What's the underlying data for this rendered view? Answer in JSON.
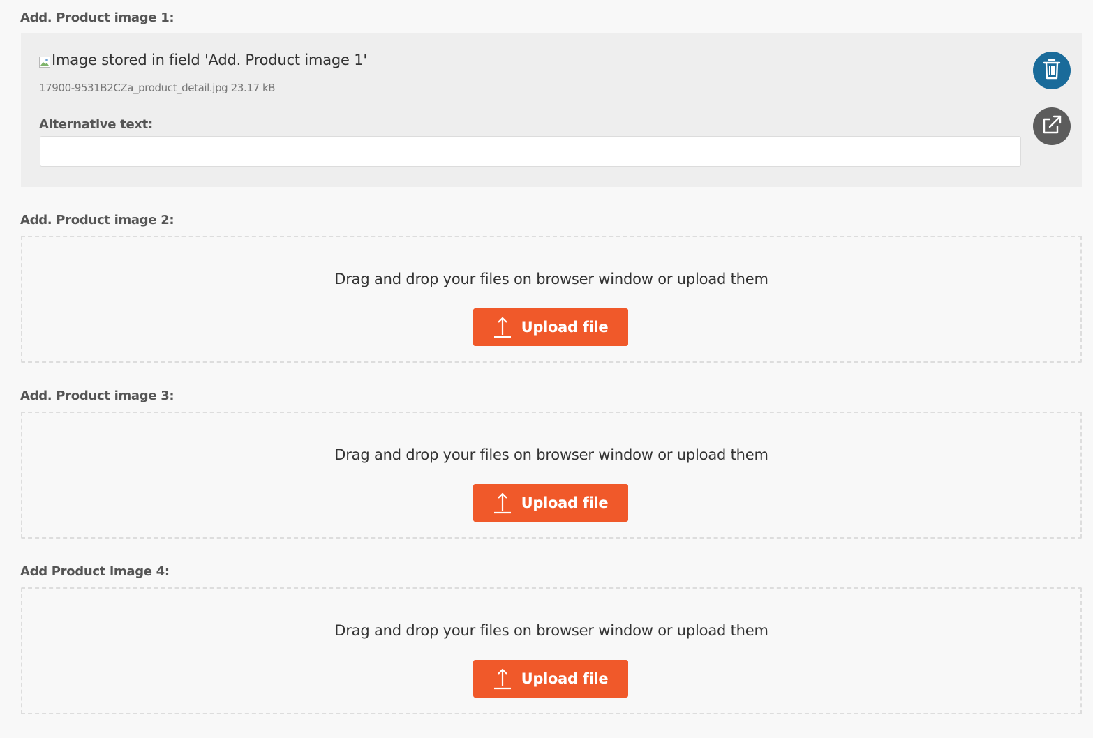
{
  "colors": {
    "accent": "#f0592a",
    "delete_button": "#1a6b9a",
    "open_button": "#5c5c5c",
    "panel_bg": "#eeeeee",
    "page_bg": "#f8f8f8"
  },
  "field1": {
    "label": "Add. Product image 1:",
    "image_alt": "Image stored in field 'Add. Product image 1'",
    "file_meta": "17900-9531B2CZa_product_detail.jpg 23.17 kB",
    "alt_text_label": "Alternative text:",
    "alt_text_value": "",
    "delete_icon": "trash-icon",
    "open_icon": "external-link-icon"
  },
  "field2": {
    "label": "Add. Product image 2:",
    "dropzone_text": "Drag and drop your files on browser window or upload them",
    "upload_label": "Upload file",
    "upload_icon": "upload-arrow-icon"
  },
  "field3": {
    "label": "Add. Product image 3:",
    "dropzone_text": "Drag and drop your files on browser window or upload them",
    "upload_label": "Upload file",
    "upload_icon": "upload-arrow-icon"
  },
  "field4": {
    "label": "Add Product image 4:",
    "dropzone_text": "Drag and drop your files on browser window or upload them",
    "upload_label": "Upload file",
    "upload_icon": "upload-arrow-icon"
  }
}
